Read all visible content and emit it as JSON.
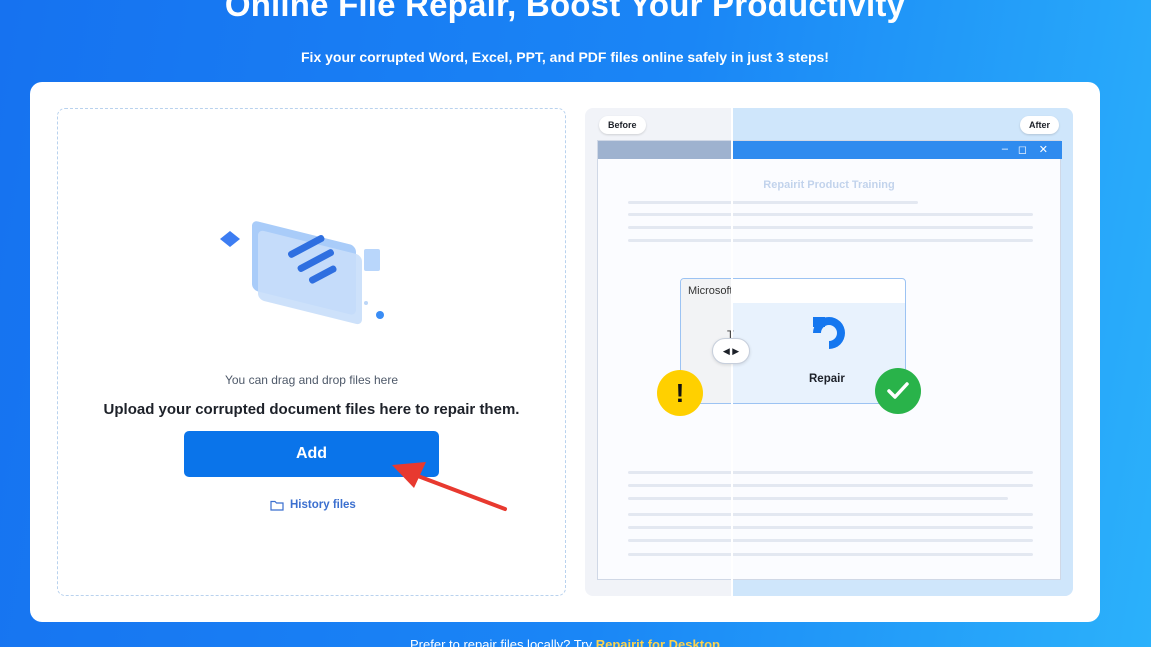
{
  "hero": {
    "title": "Online File Repair, Boost Your Productivity",
    "subtitle": "Fix your corrupted Word, Excel, PPT, and PDF files online safely in just 3 steps!"
  },
  "upload": {
    "hint": "You can drag and drop files here",
    "message": "Upload your corrupted document files here to repair them.",
    "add_label": "Add",
    "history_label": "History files"
  },
  "preview": {
    "before_label": "Before",
    "after_label": "After",
    "doc_heading": "Repairit Product Training",
    "popup_title": "Microsoft Word",
    "popup_letter": "T",
    "repair_label": "Repair",
    "win_controls": [
      "–",
      "◻",
      "✕"
    ],
    "warn_symbol": "!",
    "slider_symbol": "◀ ▶"
  },
  "footer": {
    "text": "Prefer to repair files locally? Try",
    "link": "Repairit for Desktop"
  },
  "colors": {
    "primary": "#0a74ea",
    "warning": "#ffd000",
    "success": "#29b34a",
    "annotation_arrow": "#e8392f"
  },
  "icons": {
    "history": "folder-icon",
    "warn": "warning-icon",
    "ok": "checkmark-icon",
    "repair": "repairit-logo-icon"
  }
}
